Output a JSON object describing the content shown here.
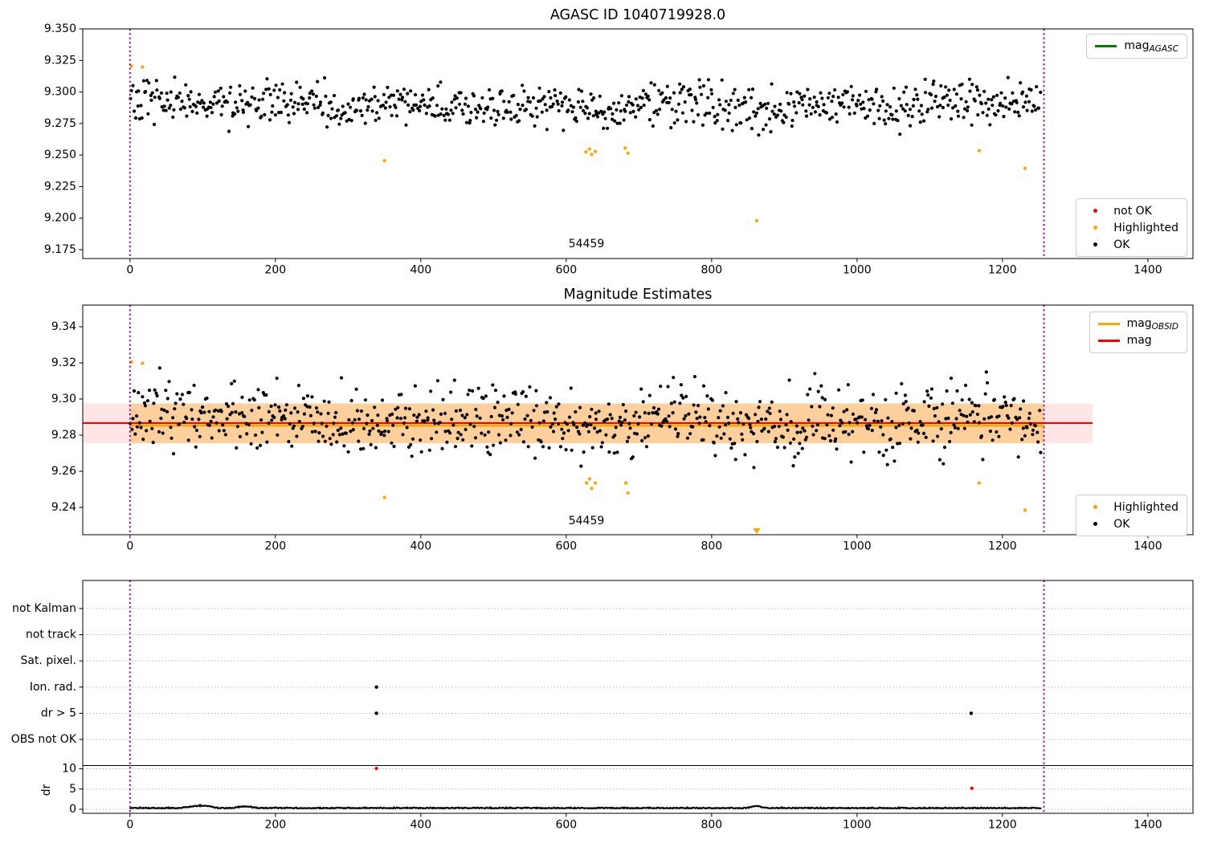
{
  "figure": {
    "background": "#ffffff"
  },
  "colors": {
    "ok": "#000000",
    "highlighted": "#ffa500",
    "not_ok": "#ff0000",
    "mag_agasc": "#008000",
    "mag": "#ff0000",
    "mag_obsid": "#ffa500",
    "obsid_vline": "#8b008b",
    "band_mag": "rgba(255,0,0,0.10)",
    "band_obsid": "rgba(255,165,0,0.32)",
    "grid": "#b8b8b8",
    "divider": "#000000"
  },
  "chart_data": [
    {
      "type": "scatter",
      "title": "AGASC ID 1040719928.0",
      "xlim": [
        -65,
        1462
      ],
      "ylim": [
        9.168,
        9.35
      ],
      "xticks": [
        0,
        200,
        400,
        600,
        800,
        1000,
        1200,
        1400
      ],
      "yticks": [
        9.175,
        9.2,
        9.225,
        9.25,
        9.275,
        9.3,
        9.325,
        9.35
      ],
      "ytick_labels": [
        "9.175",
        "9.200",
        "9.225",
        "9.250",
        "9.275",
        "9.300",
        "9.325",
        "9.350"
      ],
      "obsid_label": {
        "text": "54459",
        "x": 628
      },
      "obsid_vlines": [
        0,
        1257
      ],
      "series_ok": {
        "n": 780,
        "x_min": 0,
        "x_max": 1253,
        "y_mean": 9.2905,
        "y_std": 0.0082,
        "seed": 20557,
        "dips": [
          {
            "x": 655,
            "w": 55,
            "d": 0.0045
          },
          {
            "x": 838,
            "w": 42,
            "d": 0.0032
          }
        ]
      },
      "highlighted_points": [
        [
          2,
          9.3205
        ],
        [
          17,
          9.3198
        ],
        [
          350,
          9.2455
        ],
        [
          627,
          9.2525
        ],
        [
          632,
          9.2548
        ],
        [
          635,
          9.2505
        ],
        [
          640,
          9.2528
        ],
        [
          681,
          9.2555
        ],
        [
          685,
          9.2515
        ],
        [
          862,
          9.198
        ],
        [
          1168,
          9.2535
        ],
        [
          1231,
          9.2395
        ]
      ],
      "legend_line": {
        "items": [
          {
            "main": "mag",
            "sub": "AGASC",
            "color": "#008000"
          }
        ]
      },
      "legend_points": {
        "items": [
          {
            "label": "not OK",
            "color": "#ff0000"
          },
          {
            "label": "Highlighted",
            "color": "#ffa500"
          },
          {
            "label": "OK",
            "color": "#000000"
          }
        ]
      }
    },
    {
      "type": "scatter",
      "title": "Magnitude Estimates",
      "xlim": [
        -65,
        1462
      ],
      "ylim": [
        9.2249,
        9.352
      ],
      "xticks": [
        0,
        200,
        400,
        600,
        800,
        1000,
        1200,
        1400
      ],
      "yticks": [
        9.24,
        9.26,
        9.28,
        9.3,
        9.32,
        9.34
      ],
      "ytick_labels": [
        "9.24",
        "9.26",
        "9.28",
        "9.30",
        "9.32",
        "9.34"
      ],
      "obsid_label": {
        "text": "54459",
        "x": 628
      },
      "obsid_vlines": [
        0,
        1257
      ],
      "mag_band": {
        "low": 9.2755,
        "high": 9.2975,
        "x_min": -65,
        "x_max": 1324
      },
      "obsid_band": {
        "low": 9.2755,
        "high": 9.2975,
        "x_min": 0,
        "x_max": 1257
      },
      "mag_line": {
        "value": 9.2867,
        "x_min": -65,
        "x_max": 1324
      },
      "obsid_line": {
        "value": 9.2853,
        "x_min": 0,
        "x_max": 1257
      },
      "series_ok": {
        "n": 780,
        "x_min": 0,
        "x_max": 1253,
        "y_mean": 9.2885,
        "y_std": 0.0098,
        "seed": 9181,
        "dips": [
          {
            "x": 655,
            "w": 55,
            "d": 0.005
          },
          {
            "x": 838,
            "w": 42,
            "d": 0.0035
          }
        ]
      },
      "highlighted_points": [
        [
          2,
          9.3205
        ],
        [
          17,
          9.3198
        ],
        [
          350,
          9.2455
        ],
        [
          628,
          9.2535
        ],
        [
          632,
          9.2558
        ],
        [
          635,
          9.2505
        ],
        [
          640,
          9.2535
        ],
        [
          682,
          9.2535
        ],
        [
          685,
          9.248
        ],
        [
          1168,
          9.2535
        ],
        [
          1231,
          9.2385
        ]
      ],
      "clipped_points": [
        {
          "x": 862,
          "marker": "triangle-down"
        }
      ],
      "legend_line": {
        "items": [
          {
            "main": "mag",
            "sub": "OBSID",
            "color": "#ffa500"
          },
          {
            "main": "mag",
            "sub": "",
            "color": "#ff0000"
          }
        ]
      },
      "legend_points": {
        "items": [
          {
            "label": "Highlighted",
            "color": "#ffa500"
          },
          {
            "label": "OK",
            "color": "#000000"
          }
        ]
      }
    },
    {
      "type": "flags",
      "xlim": [
        -65,
        1462
      ],
      "xticks": [
        0,
        200,
        400,
        600,
        800,
        1000,
        1200,
        1400
      ],
      "categories": [
        "not Kalman",
        "not track",
        "Sat. pixel.",
        "Ion. rad.",
        "dr > 5",
        "OBS not OK"
      ],
      "dr_axis_label": "dr",
      "dr_ticks": [
        0,
        5,
        10
      ],
      "obsid_vlines": [
        0,
        1257
      ],
      "flag_points": [
        {
          "x": 339,
          "cat_index": 3
        },
        {
          "x": 339,
          "cat_index": 4
        },
        {
          "x": 1157,
          "cat_index": 4
        }
      ],
      "dr_points_not_ok": [
        [
          339,
          10.1
        ],
        [
          1158,
          5.2
        ]
      ],
      "dr_series": {
        "n": 1150,
        "x_min": 0,
        "x_max": 1253,
        "base": 0.22,
        "noise": 0.11,
        "seed": 4242,
        "bumps": [
          {
            "x": 92,
            "w": 11,
            "h": 0.6
          },
          {
            "x": 107,
            "w": 6,
            "h": 0.45
          },
          {
            "x": 158,
            "w": 8,
            "h": 0.45
          },
          {
            "x": 862,
            "w": 6,
            "h": 0.55
          }
        ]
      }
    }
  ]
}
